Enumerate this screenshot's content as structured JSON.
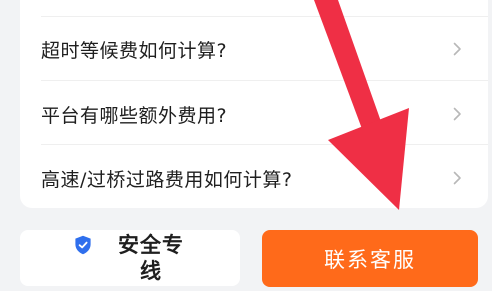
{
  "faq": {
    "items": [
      {
        "label": "超时等候费如何计算?"
      },
      {
        "label": "平台有哪些额外费用?"
      },
      {
        "label": "高速/过桥过路费用如何计算?"
      }
    ]
  },
  "bottom_bar": {
    "safety_label": "安全专线",
    "contact_label": "联系客服"
  },
  "colors": {
    "accent": "#ff6a1a",
    "shield": "#2f6fed",
    "annotation_arrow": "#ef2f45"
  },
  "icons": {
    "chevron": "chevron-right-icon",
    "shield": "shield-icon"
  }
}
